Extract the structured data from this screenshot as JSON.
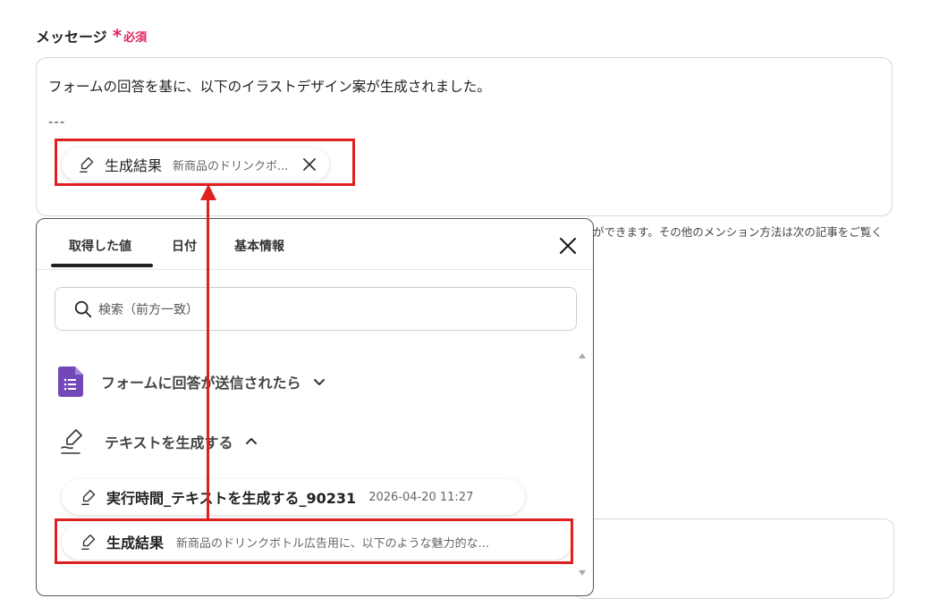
{
  "field": {
    "label": "メッセージ",
    "required_star": "*",
    "required_text": "必須"
  },
  "message": {
    "line1": "フォームの回答を基に、以下のイラストデザイン案が生成されました。",
    "line2": "---",
    "chip": {
      "title": "生成結果",
      "subtitle": "新商品のドリンクボ...",
      "icon": "pen-icon"
    }
  },
  "hint": "ができます。その他のメンション方法は次の記事をご覧く",
  "panel": {
    "tabs": [
      {
        "label": "取得した値",
        "active": true
      },
      {
        "label": "日付",
        "active": false
      },
      {
        "label": "基本情報",
        "active": false
      }
    ],
    "search_placeholder": "検索（前方一致）",
    "groups": [
      {
        "label": "フォームに回答が送信されたら",
        "icon": "google-forms-icon",
        "expanded": false
      },
      {
        "label": "テキストを生成する",
        "icon": "pen-icon",
        "expanded": true
      }
    ],
    "items": [
      {
        "title": "実行時間_テキストを生成する_90231",
        "value": "2026-04-20 11:27"
      },
      {
        "title": "生成結果",
        "value": "新商品のドリンクボトル広告用に、以下のような魅力的な..."
      }
    ]
  },
  "colors": {
    "highlight": "#e02020",
    "required": "#e0245e",
    "forms_purple": "#7248b9"
  }
}
